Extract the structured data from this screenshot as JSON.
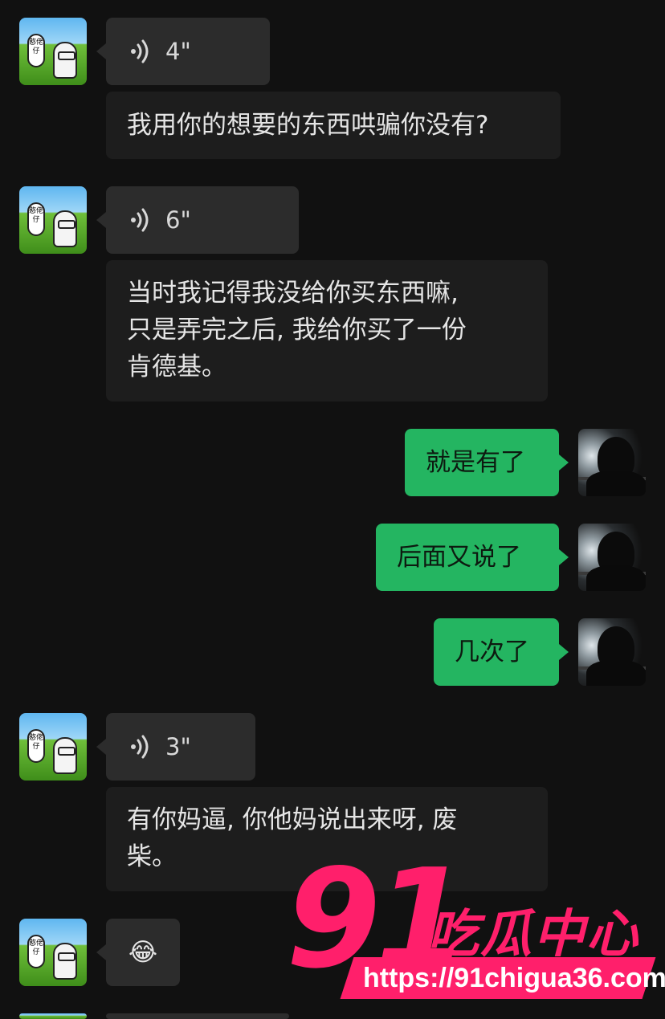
{
  "messages": [
    {
      "side": "left",
      "type": "voice",
      "duration": "4\""
    },
    {
      "side": "left",
      "type": "text",
      "text": "我用你的想要的东西哄骗你没有?"
    },
    {
      "side": "left",
      "type": "voice",
      "duration": "6\""
    },
    {
      "side": "left",
      "type": "text",
      "lines": [
        "当时我记得我没给你买东西嘛,",
        "只是弄完之后, 我给你买了一份",
        "肯德基。"
      ]
    },
    {
      "side": "right",
      "type": "text",
      "text": "就是有了"
    },
    {
      "side": "right",
      "type": "text",
      "text": "后面又说了"
    },
    {
      "side": "right",
      "type": "text",
      "text": "几次了"
    },
    {
      "side": "left",
      "type": "voice",
      "duration": "3\""
    },
    {
      "side": "left",
      "type": "text",
      "lines": [
        "有你妈逼, 你他妈说出来呀, 废",
        "柴。"
      ]
    },
    {
      "side": "left",
      "type": "emoji",
      "text": "😂"
    }
  ],
  "avatar_left": {
    "balloon_text": "憨佬仔"
  },
  "watermark": {
    "number": "91",
    "title": "吃瓜中心",
    "url": "https://91chigua36.com"
  },
  "colors": {
    "background": "#111111",
    "incoming_bubble": "#2c2c2c",
    "outgoing_bubble": "#24b561",
    "watermark": "#ff1f6b"
  },
  "icons": {
    "voice": "voice-wave-icon"
  }
}
